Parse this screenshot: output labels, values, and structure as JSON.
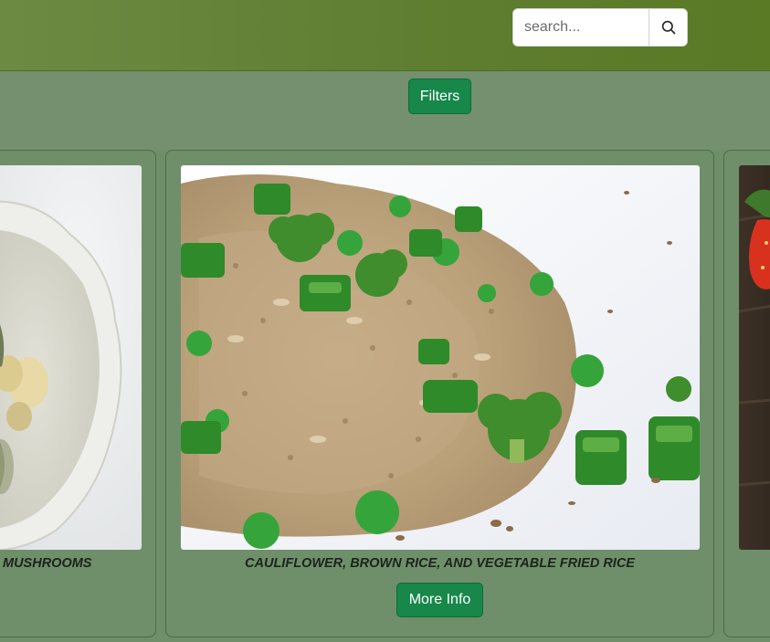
{
  "search": {
    "placeholder": "search...",
    "value": "",
    "button_icon": "search-icon"
  },
  "filters": {
    "label": "Filters"
  },
  "cards": [
    {
      "title": "MUSHROOMS",
      "image": "white bowl with mushroom soup"
    },
    {
      "title": "CAULIFLOWER, BROWN RICE, AND VEGETABLE FRIED RICE",
      "image": "fried rice with broccoli, peas and green onions",
      "button_label": "More Info"
    },
    {
      "title": "",
      "image": "strawberries on dark wood"
    }
  ],
  "colors": {
    "header": "#5f7d2f",
    "background": "#6f8f6b",
    "button": "#17874a"
  }
}
